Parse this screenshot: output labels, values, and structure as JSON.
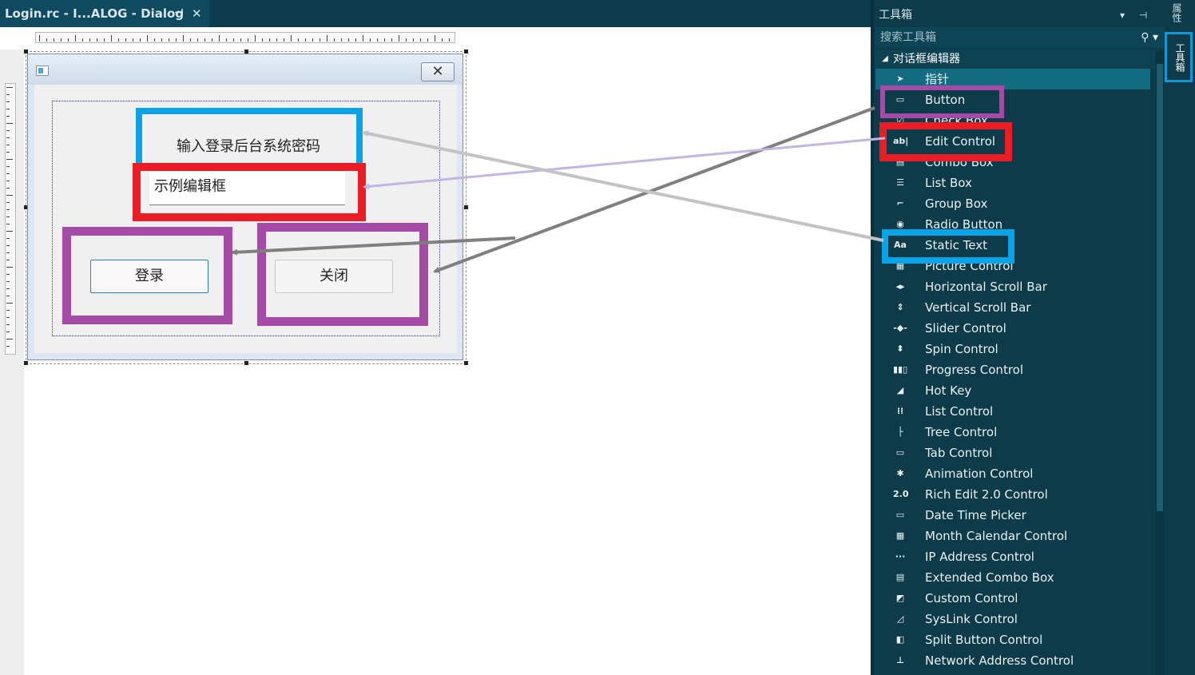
{
  "document_tab": {
    "title": "Login.rc - I...ALOG - Dialog",
    "pin_glyph": "⊣",
    "close_glyph": "✕"
  },
  "dialog": {
    "close_glyph": "✕",
    "static_text": "输入登录后台系统密码",
    "edit_text": "示例编辑框",
    "login_button": "登录",
    "close_button": "关闭"
  },
  "toolbox": {
    "title": "工具箱",
    "title_controls": "▾ ⊣ ✕",
    "search_placeholder": "搜索工具箱",
    "search_icon": "⚲ ▾",
    "group": "对话框编辑器",
    "group_arrow": "◢",
    "items": [
      {
        "label": "指针",
        "icon": "pointer-icon",
        "glyph": "➤",
        "selected": true
      },
      {
        "label": "Button",
        "icon": "button-icon",
        "glyph": "▭"
      },
      {
        "label": "Check Box",
        "icon": "checkbox-icon",
        "glyph": "☑"
      },
      {
        "label": "Edit Control",
        "icon": "edit-control-icon",
        "glyph": "ab|"
      },
      {
        "label": "Combo Box",
        "icon": "combo-box-icon",
        "glyph": "▤"
      },
      {
        "label": "List Box",
        "icon": "list-box-icon",
        "glyph": "☰"
      },
      {
        "label": "Group Box",
        "icon": "group-box-icon",
        "glyph": "⌐"
      },
      {
        "label": "Radio Button",
        "icon": "radio-button-icon",
        "glyph": "◉"
      },
      {
        "label": "Static Text",
        "icon": "static-text-icon",
        "glyph": "Aa"
      },
      {
        "label": "Picture Control",
        "icon": "picture-control-icon",
        "glyph": "▦"
      },
      {
        "label": "Horizontal Scroll Bar",
        "icon": "horizontal-scroll-bar-icon",
        "glyph": "◂▸"
      },
      {
        "label": "Vertical Scroll Bar",
        "icon": "vertical-scroll-bar-icon",
        "glyph": "⇕"
      },
      {
        "label": "Slider Control",
        "icon": "slider-control-icon",
        "glyph": "-◆-"
      },
      {
        "label": "Spin Control",
        "icon": "spin-control-icon",
        "glyph": "⬍"
      },
      {
        "label": "Progress Control",
        "icon": "progress-control-icon",
        "glyph": "▮▮▯"
      },
      {
        "label": "Hot Key",
        "icon": "hot-key-icon",
        "glyph": "◢"
      },
      {
        "label": "List Control",
        "icon": "list-control-icon",
        "glyph": "⁞⁞"
      },
      {
        "label": "Tree Control",
        "icon": "tree-control-icon",
        "glyph": "├"
      },
      {
        "label": "Tab Control",
        "icon": "tab-control-icon",
        "glyph": "▭"
      },
      {
        "label": "Animation Control",
        "icon": "animation-control-icon",
        "glyph": "✱"
      },
      {
        "label": "Rich Edit 2.0 Control",
        "icon": "rich-edit-icon",
        "glyph": "2.0"
      },
      {
        "label": "Date Time Picker",
        "icon": "date-time-picker-icon",
        "glyph": "▭"
      },
      {
        "label": "Month Calendar Control",
        "icon": "month-calendar-icon",
        "glyph": "▦"
      },
      {
        "label": "IP Address Control",
        "icon": "ip-address-icon",
        "glyph": "···"
      },
      {
        "label": "Extended Combo Box",
        "icon": "extended-combo-box-icon",
        "glyph": "▤"
      },
      {
        "label": "Custom Control",
        "icon": "custom-control-icon",
        "glyph": "◩"
      },
      {
        "label": "SysLink Control",
        "icon": "syslink-control-icon",
        "glyph": "◿"
      },
      {
        "label": "Split Button Control",
        "icon": "split-button-icon",
        "glyph": "◧"
      },
      {
        "label": "Network Address Control",
        "icon": "network-address-icon",
        "glyph": "⊥"
      }
    ]
  },
  "dock": {
    "properties_tab": "属性",
    "toolbox_tab": "工具箱"
  },
  "colors": {
    "annotation_blue": "#0aa4e6",
    "annotation_red": "#ec1c24",
    "annotation_purple": "#a54aa6",
    "arrow_gray": "#7f7f7f",
    "arrow_light_gray": "#c3c3c3",
    "arrow_lavender": "#c2b4e4",
    "toolbox_bg": "#0e3b4a",
    "selected_item": "#126b80"
  }
}
